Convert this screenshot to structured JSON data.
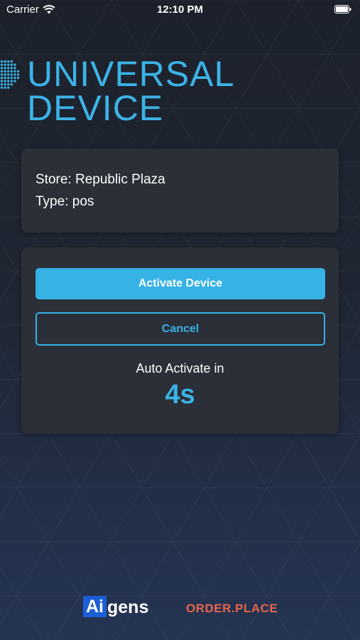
{
  "status_bar": {
    "carrier": "Carrier",
    "time": "12:10 PM"
  },
  "brand": {
    "title_line1": "UNIVERSAL",
    "title_line2": "DEVICE",
    "color": "#3bb3e6"
  },
  "info": {
    "store": "Store: Republic Plaza",
    "type": "Type: pos"
  },
  "actions": {
    "activate_label": "Activate Device",
    "cancel_label": "Cancel",
    "auto_label": "Auto Activate in",
    "countdown": "4s",
    "accent_color": "#36b2e5"
  },
  "footer": {
    "aigens_ai": "Ai",
    "aigens_rest": "gens",
    "orderplace": "ORDER.PLACE"
  },
  "icons": [
    "wifi-icon",
    "battery-icon",
    "universal-device-logo-mark"
  ]
}
